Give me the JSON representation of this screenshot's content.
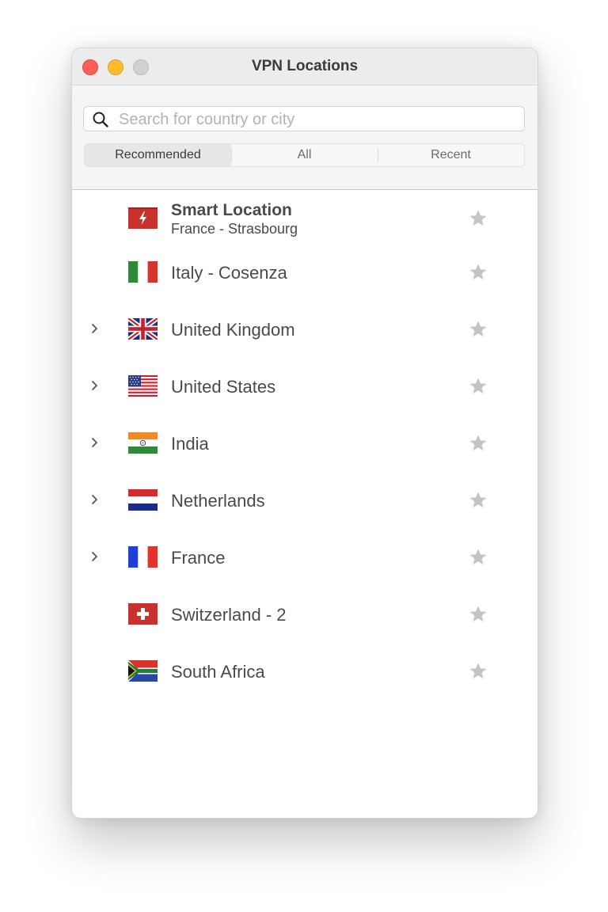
{
  "window": {
    "title": "VPN Locations"
  },
  "search": {
    "placeholder": "Search for country or city",
    "icon": "magnifier-icon"
  },
  "tabs": [
    {
      "label": "Recommended",
      "active": true
    },
    {
      "label": "All",
      "active": false
    },
    {
      "label": "Recent",
      "active": false
    }
  ],
  "locations": [
    {
      "name": "Smart Location",
      "subtitle": "France - Strasbourg",
      "expandable": false,
      "flag": "smart-location-icon",
      "starred": false
    },
    {
      "name": "Italy - Cosenza",
      "expandable": false,
      "flag": "italy-flag-icon",
      "starred": false
    },
    {
      "name": "United Kingdom",
      "expandable": true,
      "flag": "uk-flag-icon",
      "starred": false
    },
    {
      "name": "United States",
      "expandable": true,
      "flag": "us-flag-icon",
      "starred": false
    },
    {
      "name": "India",
      "expandable": true,
      "flag": "india-flag-icon",
      "starred": false
    },
    {
      "name": "Netherlands",
      "expandable": true,
      "flag": "netherlands-flag-icon",
      "starred": false
    },
    {
      "name": "France",
      "expandable": true,
      "flag": "france-flag-icon",
      "starred": false
    },
    {
      "name": "Switzerland - 2",
      "expandable": false,
      "flag": "switzerland-flag-icon",
      "starred": false
    },
    {
      "name": "South Africa",
      "expandable": false,
      "flag": "south-africa-flag-icon",
      "starred": false
    }
  ],
  "colors": {
    "star": "#c4c4c4",
    "text": "#4a4a4a",
    "smart_location_red": "#c8312e"
  }
}
